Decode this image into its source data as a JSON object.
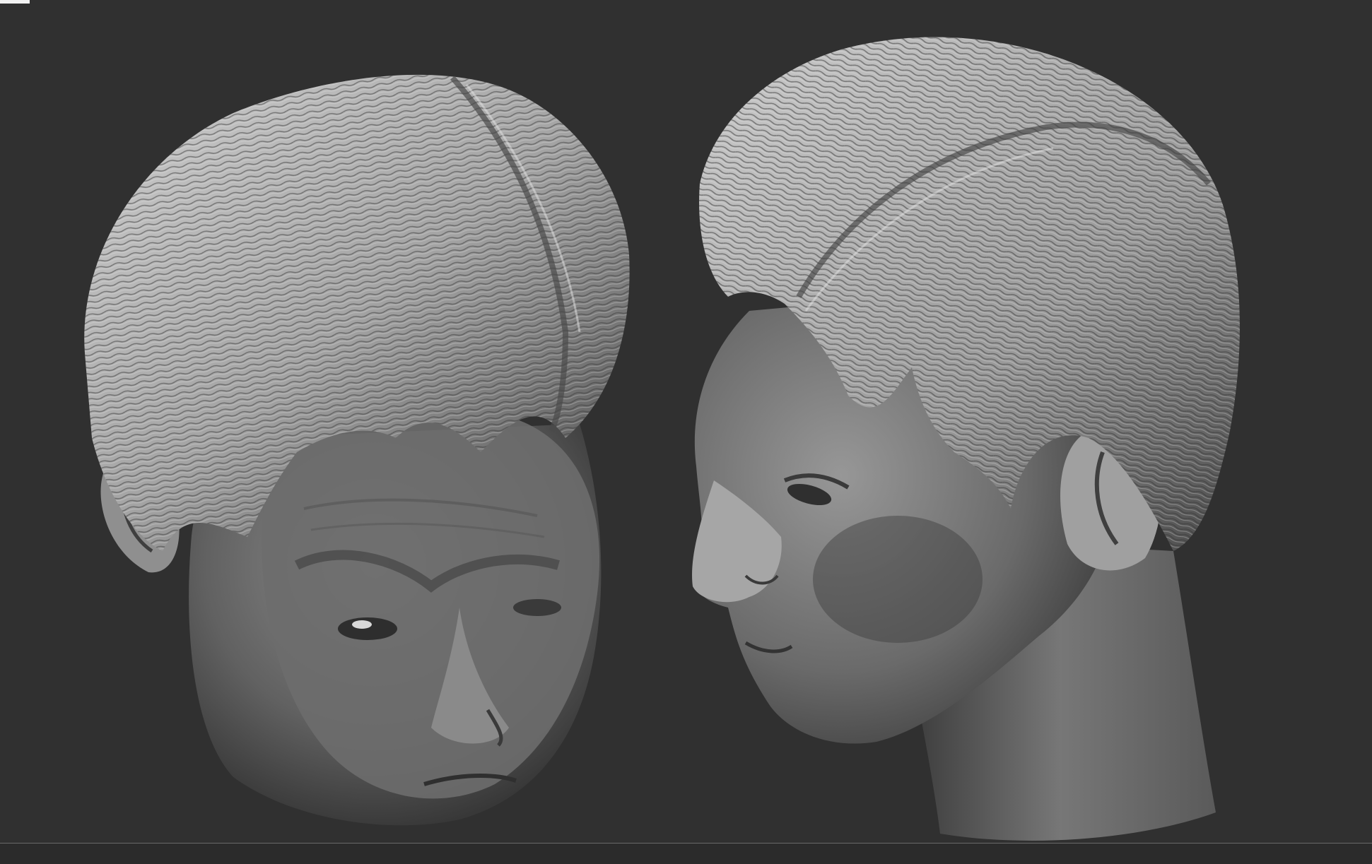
{
  "viewport": {
    "background": "#303030",
    "accent": "#f2f2f2"
  },
  "models": [
    {
      "name": "head-sculpt-front-down",
      "material": "matcap-gray"
    },
    {
      "name": "head-sculpt-side-profile",
      "material": "matcap-gray"
    }
  ],
  "status_bar": {
    "background": "#2b2b2b"
  }
}
